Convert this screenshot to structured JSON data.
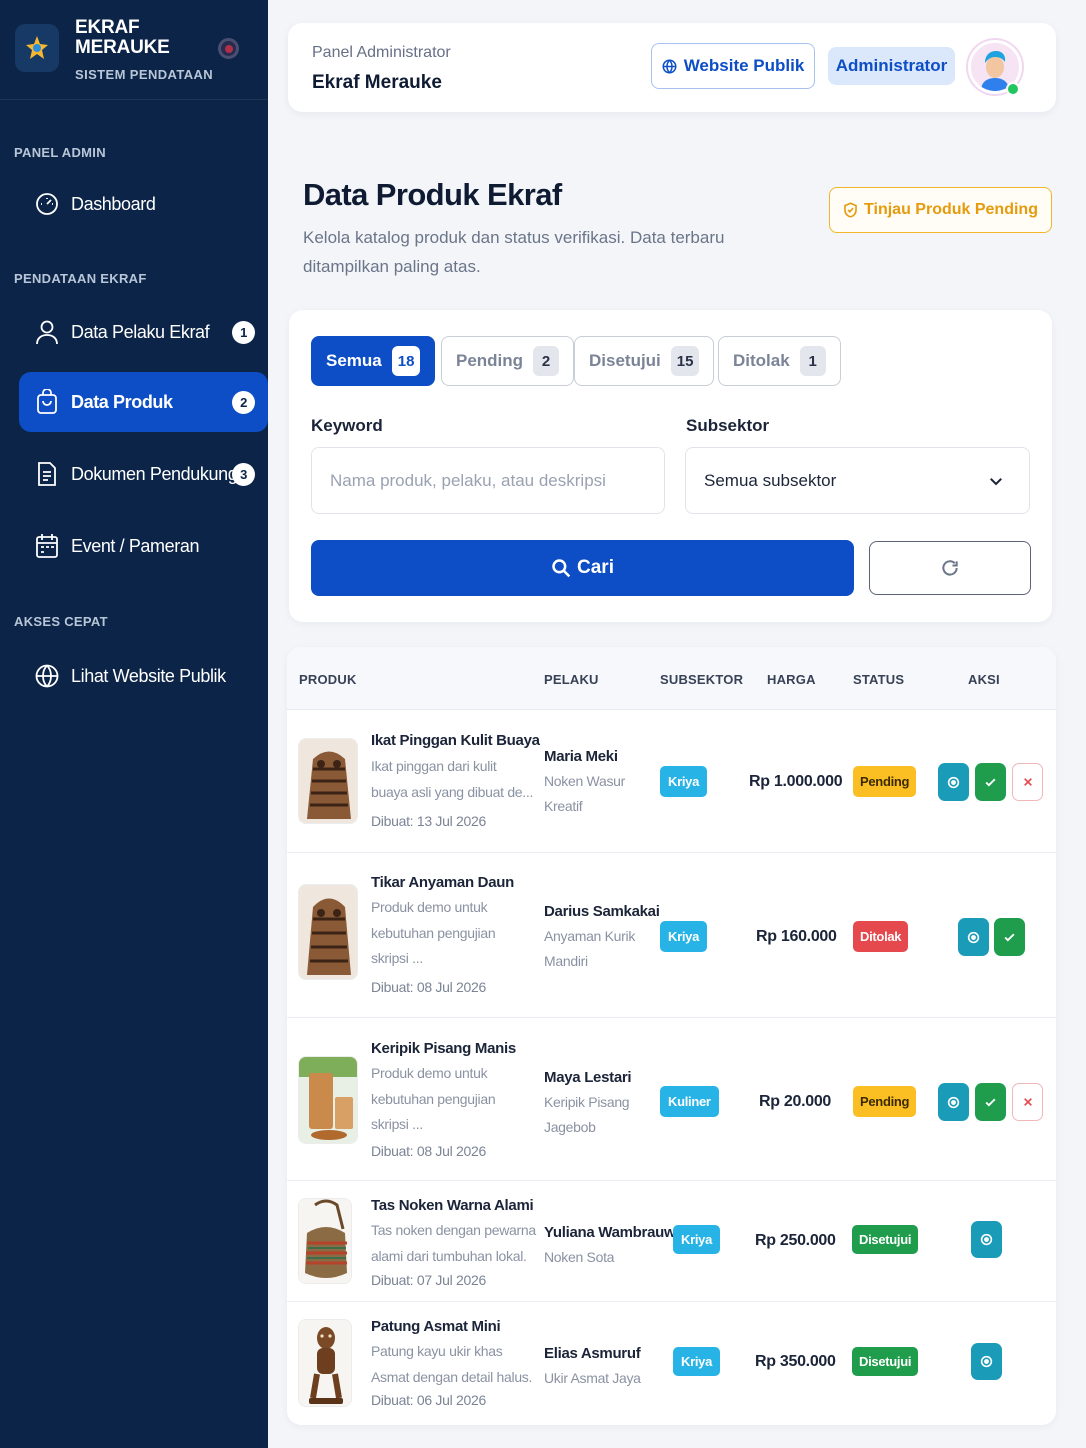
{
  "sidebar": {
    "brand_title": "EKRAF\nMERAUKE",
    "brand_line1": "EKRAF",
    "brand_line2": "MERAUKE",
    "brand_subtitle": "SISTEM PENDATAAN",
    "sections": {
      "panel_admin": "PANEL ADMIN",
      "pendataan": "PENDATAAN EKRAF",
      "akses_cepat": "AKSES CEPAT"
    },
    "items": [
      {
        "label": "Dashboard",
        "icon": "gauge-icon"
      },
      {
        "label": "Data Pelaku Ekraf",
        "icon": "user-icon",
        "badge": "1"
      },
      {
        "label": "Data Produk",
        "icon": "bag-icon",
        "badge": "2",
        "active": true
      },
      {
        "label": "Dokumen Pendukung",
        "icon": "document-icon",
        "badge": "3"
      },
      {
        "label": "Event / Pameran",
        "icon": "calendar-icon"
      },
      {
        "label": "Lihat Website Publik",
        "icon": "globe-icon"
      }
    ],
    "colors": {
      "background": "#0b2447",
      "active": "#0d4ec6"
    }
  },
  "header": {
    "kicker": "Panel Administrator",
    "title": "Ekraf Merauke",
    "website_button": "Website Publik",
    "role": "Administrator"
  },
  "page": {
    "title": "Data Produk Ekraf",
    "description": "Kelola katalog produk dan status verifikasi. Data terbaru ditampilkan paling atas.",
    "review_button": "Tinjau Produk Pending"
  },
  "filters": {
    "tabs": [
      {
        "label": "Semua",
        "count": "18",
        "active": true
      },
      {
        "label": "Pending",
        "count": "2"
      },
      {
        "label": "Disetujui",
        "count": "15"
      },
      {
        "label": "Ditolak",
        "count": "1"
      }
    ],
    "keyword_label": "Keyword",
    "keyword_placeholder": "Nama produk, pelaku, atau deskripsi",
    "keyword_value": "",
    "subsektor_label": "Subsektor",
    "subsektor_value": "Semua subsektor",
    "search_button": "Cari"
  },
  "table": {
    "headers": [
      "PRODUK",
      "PELAKU",
      "SUBSEKTOR",
      "HARGA",
      "STATUS",
      "AKSI"
    ],
    "rows": [
      {
        "name": "Ikat Pinggan Kulit Buaya",
        "desc": "Ikat pinggan dari kulit buaya asli yang dibuat de...",
        "date": "Dibuat: 13 Jul 2026",
        "pelaku": "Maria Meki",
        "usaha": "Noken Wasur Kreatif",
        "subsektor": "Kriya",
        "harga": "Rp 1.000.000",
        "status": "Pending",
        "thumb": "carving"
      },
      {
        "name": "Tikar Anyaman Daun",
        "desc": "Produk demo untuk kebutuhan pengujian skripsi ...",
        "date": "Dibuat: 08 Jul 2026",
        "pelaku": "Darius Samkakai",
        "usaha": "Anyaman Kurik Mandiri",
        "subsektor": "Kriya",
        "harga": "Rp 160.000",
        "status": "Ditolak",
        "thumb": "carving"
      },
      {
        "name": "Keripik Pisang Manis",
        "desc": "Produk demo untuk kebutuhan pengujian skripsi ...",
        "date": "Dibuat: 08 Jul 2026",
        "pelaku": "Maya Lestari",
        "usaha": "Keripik Pisang Jagebob",
        "subsektor": "Kuliner",
        "harga": "Rp 20.000",
        "status": "Pending",
        "thumb": "snack"
      },
      {
        "name": "Tas Noken Warna Alami",
        "desc": "Tas noken dengan pewarna alami dari tumbuhan lokal.",
        "date": "Dibuat: 07 Jul 2026",
        "pelaku": "Yuliana Wambrauw",
        "usaha": "Noken Sota",
        "subsektor": "Kriya",
        "harga": "Rp 250.000",
        "status": "Disetujui",
        "thumb": "bag"
      },
      {
        "name": "Patung Asmat Mini",
        "desc": "Patung kayu ukir khas Asmat dengan detail halus.",
        "date": "Dibuat: 06 Jul 2026",
        "pelaku": "Elias Asmuruf",
        "usaha": "Ukir Asmat Jaya",
        "subsektor": "Kriya",
        "harga": "Rp 350.000",
        "status": "Disetujui",
        "thumb": "statue"
      }
    ]
  },
  "colors": {
    "primary": "#0d4ec6",
    "pending": "#fbbf24",
    "ditolak": "#e5484d",
    "disetujui": "#1f9d4d",
    "subsektor_chip": "#27b3e6"
  }
}
